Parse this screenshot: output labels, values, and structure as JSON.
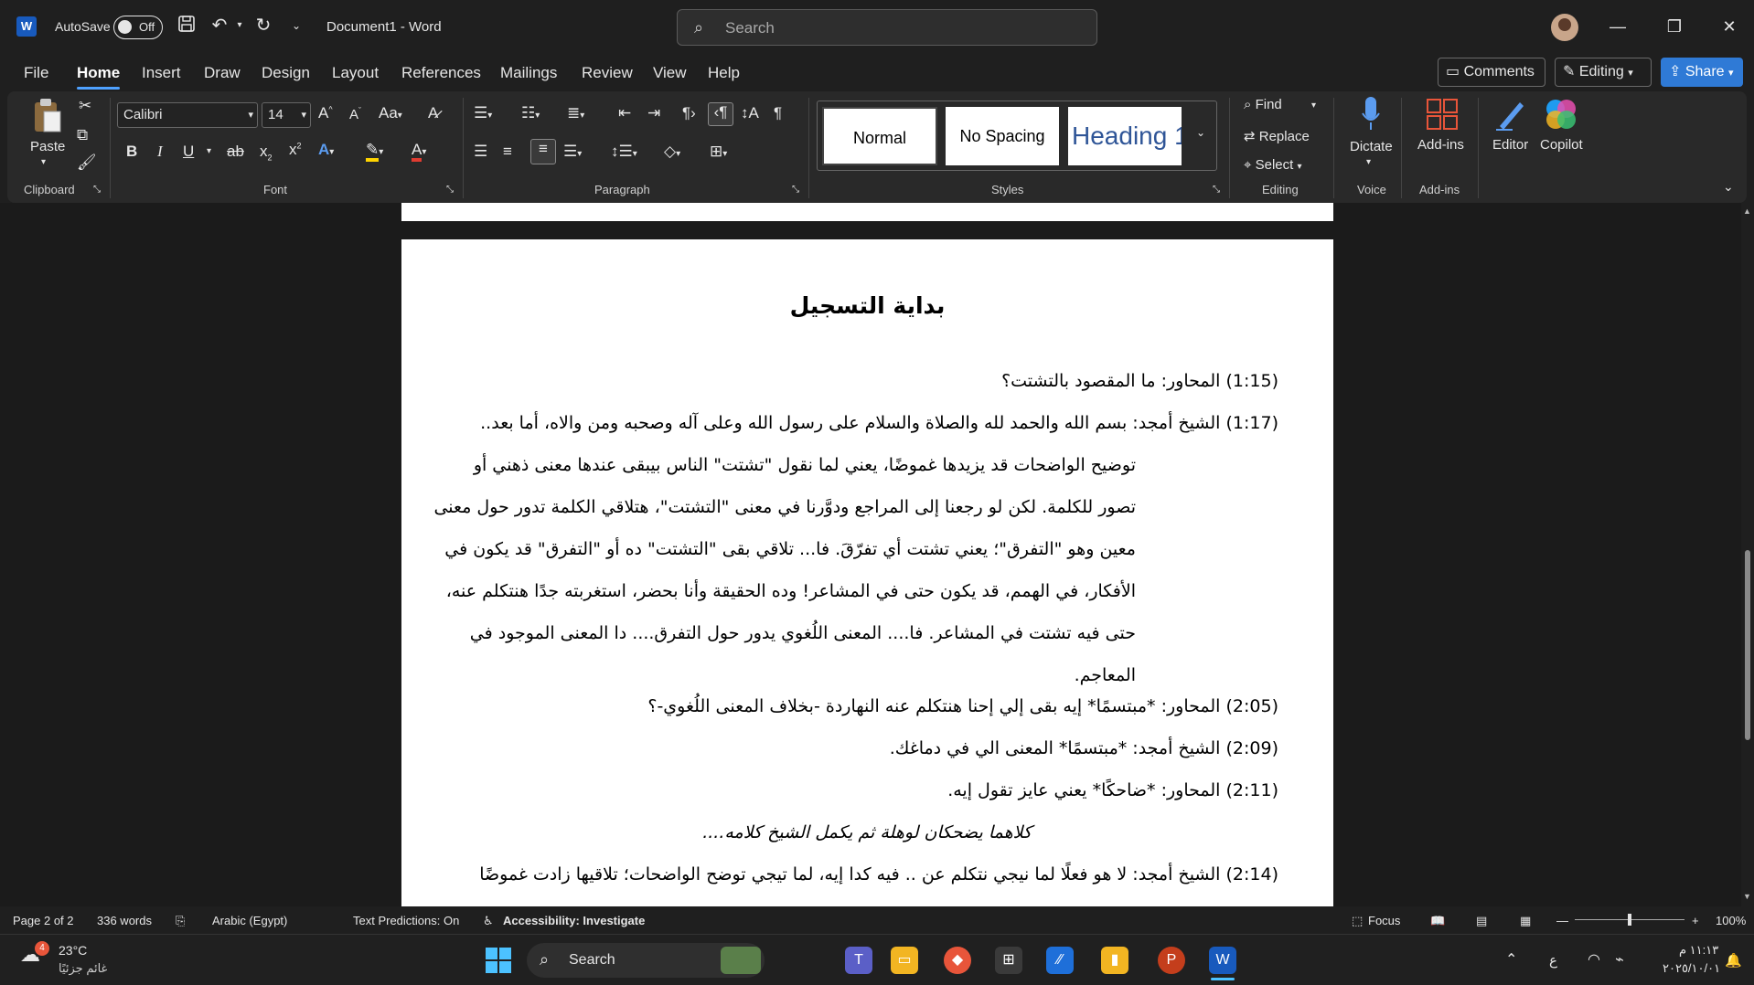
{
  "titlebar": {
    "app_icon": "W",
    "autosave_label": "AutoSave",
    "autosave_state": "Off",
    "document_title": "Document1  -  Word",
    "search_placeholder": "Search",
    "minimize": "—",
    "restore": "❐",
    "close": "✕"
  },
  "menu": {
    "tabs": [
      "File",
      "Home",
      "Insert",
      "Draw",
      "Design",
      "Layout",
      "References",
      "Mailings",
      "Review",
      "View",
      "Help"
    ],
    "active_tab": "Home",
    "comments_label": "Comments",
    "editing_label": "Editing",
    "share_label": "Share"
  },
  "ribbon": {
    "clipboard": {
      "paste_label": "Paste",
      "group_label": "Clipboard"
    },
    "font": {
      "font_name": "Calibri",
      "font_size": "14",
      "group_label": "Font"
    },
    "paragraph": {
      "group_label": "Paragraph"
    },
    "styles": {
      "items": [
        "Normal",
        "No Spacing",
        "Heading 1"
      ],
      "group_label": "Styles"
    },
    "editing": {
      "find": "Find",
      "replace": "Replace",
      "select": "Select",
      "group_label": "Editing"
    },
    "voice": {
      "dictate": "Dictate",
      "group_label": "Voice"
    },
    "addins": {
      "addins": "Add-ins",
      "group_label": "Add-ins"
    },
    "editor": "Editor",
    "copilot": "Copilot"
  },
  "document": {
    "heading": "بداية التسجيل",
    "paragraphs": [
      "(1:15) المحاور: ما المقصود بالتشتت؟",
      "(1:17) الشيخ أمجد: بسم الله والحمد لله والصلاة والسلام على رسول الله وعلى آله وصحبه ومن والاه، أما بعد..",
      "توضيح الواضحات قد يزيدها غموضًا، يعني لما نقول \"تشتت\" الناس بيبقى عندها معنى ذهني أو",
      "تصور للكلمة. لكن لو رجعنا إلى المراجع ودوَّرنا في معنى \"التشتت\"، هتلاقي الكلمة تدور حول معنى",
      "معين وهو \"التفرق\"؛ يعني تشتت أي تفرّقَ. فا... تلاقي بقى \"التشتت\" ده أو \"التفرق\" قد يكون في",
      "الأفكار، في الهمم، قد يكون حتى في المشاعر! وده الحقيقة وأنا بحضر، استغربته جدًا هنتكلم عنه،",
      "حتى فيه تشتت في المشاعر. فا.... المعنى اللُغوي يدور حول التفرق.... دا المعنى الموجود في",
      "المعاجم.",
      "(2:05) المحاور: *مبتسمًا* إيه بقى إلي إحنا هنتكلم عنه النهاردة -بخلاف المعنى اللُغوي-؟",
      "(2:09) الشيخ أمجد: *مبتسمًا*  المعنى الي في دماغك.",
      "(2:11) المحاور: *ضاحكًا*  يعني عايز تقول إيه.",
      "كلاهما يضحكان لوهلة ثم يكمل الشيخ كلامه....",
      "(2:14) الشيخ أمجد: لا هو فعلًا لما نيجي نتكلم عن .. فيه كدا إيه، لما تيجي توضح الواضحات؛ تلاقيها زادت غموضًا"
    ]
  },
  "statusbar": {
    "page": "Page 2 of 2",
    "words": "336 words",
    "language": "Arabic (Egypt)",
    "text_predictions": "Text Predictions: On",
    "accessibility": "Accessibility: Investigate",
    "focus": "Focus",
    "zoom": "100%"
  },
  "taskbar": {
    "weather_temp": "23°C",
    "weather_desc": "غائم جزئيًا",
    "weather_badge": "4",
    "search_label": "Search",
    "lang": "ع",
    "time": "١١:١٣ م",
    "date": "٢٠٢٥/١٠/٠١"
  },
  "colors": {
    "accent": "#4ea1ff",
    "share": "#2f7ad6",
    "word_blue": "#185abd"
  }
}
